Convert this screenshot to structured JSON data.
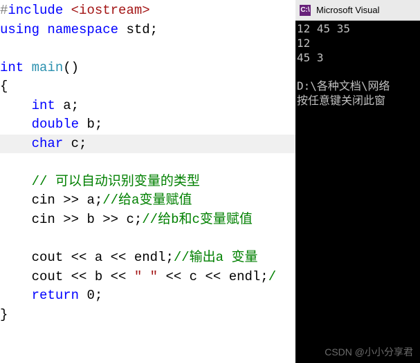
{
  "code": {
    "hash": "#",
    "directive": "include",
    "sp": " ",
    "lt": "<",
    "gt": ">",
    "header": "iostream",
    "using": "using",
    "namespace": "namespace",
    "std": "std",
    "int_kw": "int",
    "main": "main",
    "lparen": "(",
    "rparen": ")",
    "lbrace": "{",
    "rbrace": "}",
    "indent": "    ",
    "double_kw": "double",
    "char_kw": "char",
    "a": "a",
    "b": "b",
    "c": "c",
    "semi": ";",
    "cmt_auto": "// 可以自动识别变量的类型",
    "cin": "cin",
    "extr": " >> ",
    "cmt_a": "//给a变量赋值",
    "cmt_bc": "//给b和c变量赋值",
    "cout": "cout",
    "ins": " << ",
    "endl": "endl",
    "cmt_outa": "//输出a 变量",
    "str_sp": "\" \"",
    "cmt_tail": "/",
    "return_kw": "return",
    "zero": "0"
  },
  "console": {
    "title": "Microsoft Visual",
    "icon_label": "C:\\",
    "line1": "12 45 35",
    "line2": "12",
    "line3": "45 3",
    "blank": "",
    "path": "D:\\各种文档\\网络",
    "prompt": "按任意键关闭此窗"
  },
  "watermark": "CSDN @小小分享君"
}
